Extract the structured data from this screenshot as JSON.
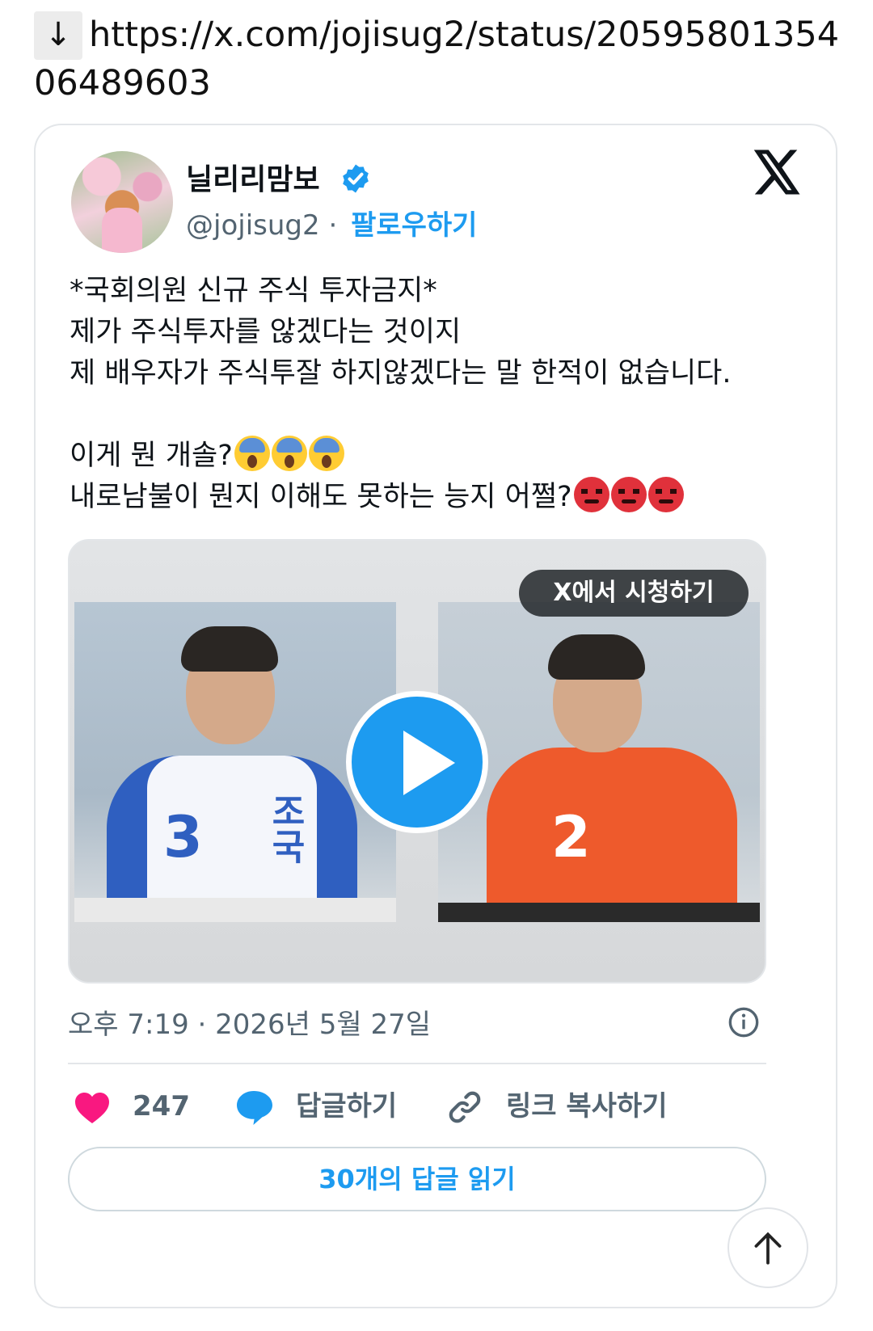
{
  "url_bar": {
    "download_icon": "↓",
    "url": "https://x.com/jojisug2/status/2059580135406489603"
  },
  "tweet": {
    "display_name": "닐리리맘보",
    "handle": "@jojisug2",
    "separator": "·",
    "follow_label": "팔로우하기",
    "text_lines": [
      "*국회의원 신규 주식 투자금지*",
      "제가 주식투자를 않겠다는 것이지",
      "제 배우자가 주식투잘 하지않겠다는 말 한적이 없습니다.",
      "",
      "이게 뭔 개솔?",
      "내로남불이 뭔지 이해도 못하는 능지 어쩔?"
    ],
    "emoji_line5": [
      "screaming-face",
      "screaming-face",
      "screaming-face"
    ],
    "emoji_line6": [
      "angry-face",
      "angry-face",
      "angry-face"
    ],
    "media": {
      "watch_label": "X에서 시청하기",
      "left_jersey_number": "3",
      "left_jersey_name": "조국",
      "right_jersey_number": "2"
    },
    "timestamp": "오후 7:19 · 2026년 5월 27일",
    "likes_count": "247",
    "reply_label": "답글하기",
    "copy_link_label": "링크 복사하기",
    "read_replies_label": "30개의 답글 읽기"
  },
  "colors": {
    "accent": "#1d9bf0",
    "like": "#f91880",
    "text_primary": "#0f1419",
    "text_secondary": "#536471"
  },
  "icons": [
    "download-icon",
    "verified-icon",
    "x-logo-icon",
    "play-icon",
    "info-icon",
    "heart-icon",
    "reply-bubble-icon",
    "link-icon",
    "arrow-up-icon"
  ]
}
